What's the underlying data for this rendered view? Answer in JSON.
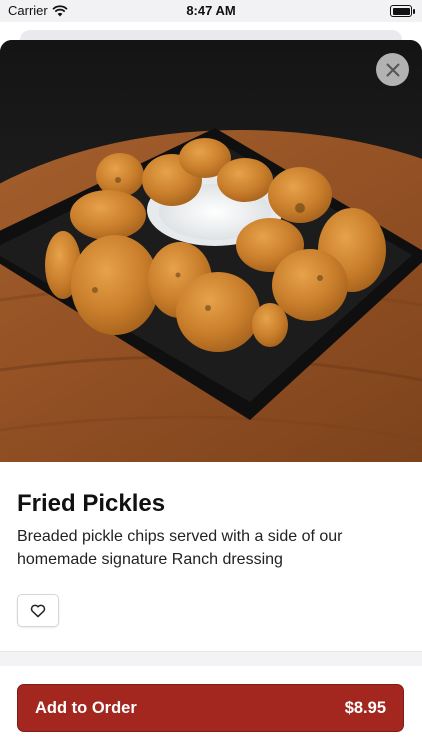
{
  "status_bar": {
    "carrier": "Carrier",
    "time": "8:47 AM"
  },
  "item": {
    "name": "Fried Pickles",
    "description": "Breaded pickle chips served with a side of our homemade signature Ranch dressing",
    "image_icon": "fried-pickles-photo"
  },
  "actions": {
    "close_icon": "close-icon",
    "favorite_icon": "heart-icon",
    "add_to_order_label": "Add to Order",
    "price": "$8.95"
  },
  "colors": {
    "accent": "#a3261f",
    "background": "#ffffff"
  }
}
